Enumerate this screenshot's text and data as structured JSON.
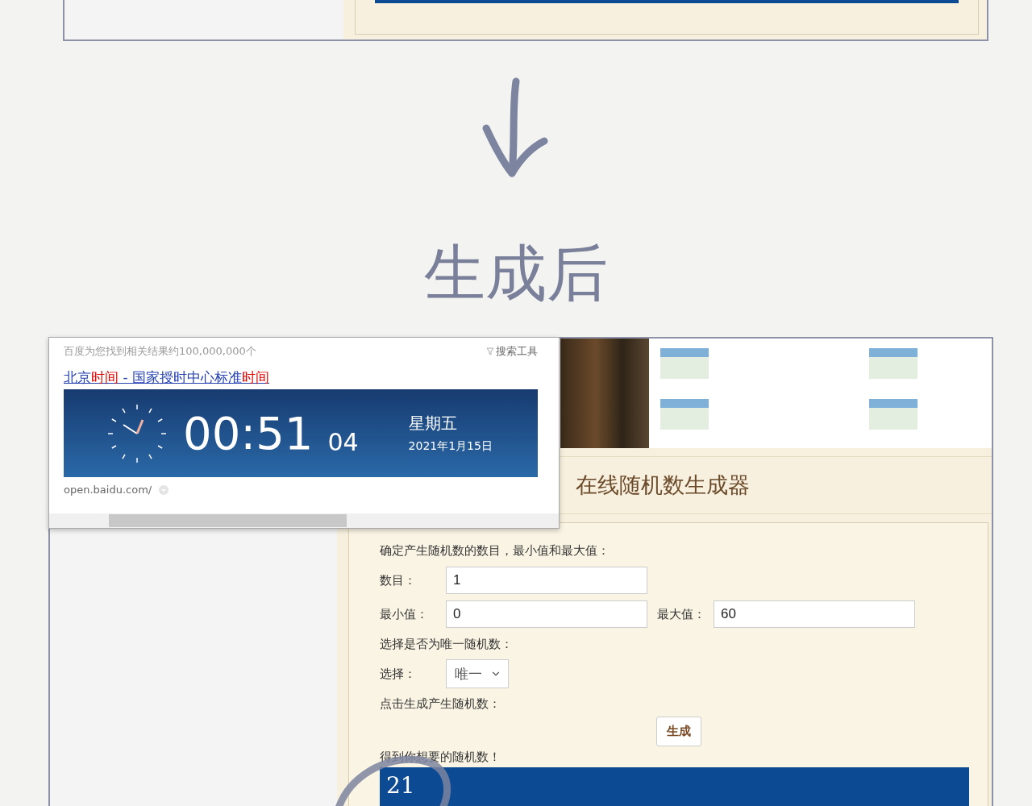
{
  "heading": "生成后",
  "search_popup": {
    "result_count": "百度为您找到相关结果约100,000,000个",
    "tools": "搜索工具",
    "title": [
      {
        "text": "北京",
        "highlight": false
      },
      {
        "text": "时间",
        "highlight": true
      },
      {
        "text": " - 国家授时中心标准",
        "highlight": false
      },
      {
        "text": "时间",
        "highlight": true
      }
    ],
    "clock": {
      "time": "00:51",
      "seconds": "04",
      "weekday": "星期五",
      "date": "2021年1月15日"
    },
    "url": "open.baidu.com/"
  },
  "generator": {
    "title": "在线随机数生成器",
    "intro": "确定产生随机数的数目，最小值和最大值：",
    "fields": [
      {
        "label": "数目：",
        "value": "1"
      },
      {
        "label": "最小值：",
        "value": "0"
      },
      {
        "label": "最大值：",
        "value": "60"
      }
    ],
    "unique_prompt": "选择是否为唯一随机数：",
    "select": {
      "label": "选择：",
      "value": "唯一"
    },
    "generate_prompt": "点击生成产生随机数：",
    "generate_button": "生成",
    "result_label": "得到你想要的随机数！",
    "result": "21"
  }
}
